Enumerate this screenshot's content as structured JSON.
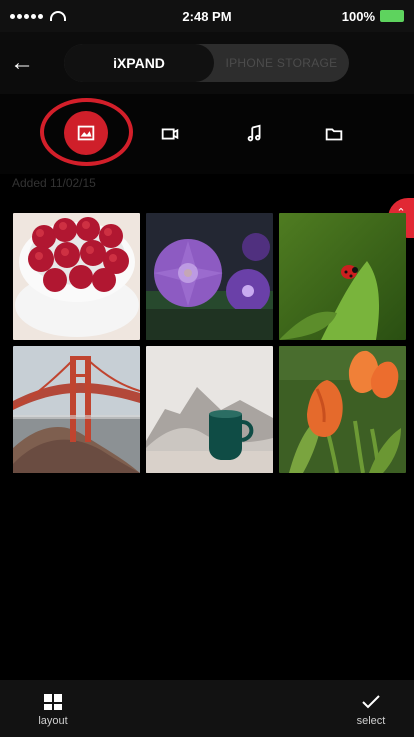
{
  "statusbar": {
    "time": "2:48 PM",
    "battery": "100%"
  },
  "header": {
    "back_icon": "back-arrow-icon",
    "tabs": [
      {
        "label": "iXPAND"
      },
      {
        "label": "IPHONE STORAGE"
      }
    ]
  },
  "filters": [
    {
      "name": "photos",
      "icon": "image-icon"
    },
    {
      "name": "videos",
      "icon": "video-icon"
    },
    {
      "name": "music",
      "icon": "music-icon"
    },
    {
      "name": "folders",
      "icon": "folder-icon"
    }
  ],
  "content": {
    "section_label": "Added 11/02/15",
    "items": [
      {
        "name": "raspberries-photo"
      },
      {
        "name": "purple-flower-photo"
      },
      {
        "name": "ladybug-photo"
      },
      {
        "name": "golden-gate-photo"
      },
      {
        "name": "coffee-cup-photo"
      },
      {
        "name": "tulips-photo"
      }
    ]
  },
  "bottom_bar": {
    "layout_label": "layout",
    "select_label": "select"
  },
  "colors": {
    "accent": "#cf1f2a",
    "battery": "#5ed35e"
  }
}
